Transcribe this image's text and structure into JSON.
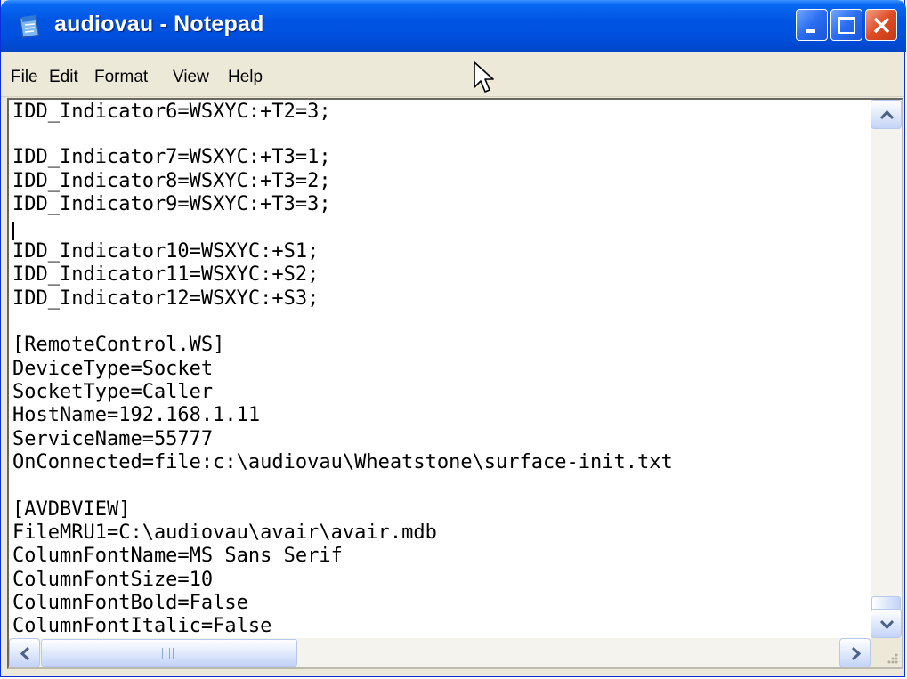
{
  "window": {
    "title": "audiovau - Notepad",
    "colors": {
      "titlebar": "#0054e3",
      "close": "#e04a22",
      "menubar": "#ece9d8"
    }
  },
  "titlebar": {
    "icons": {
      "app": "notepad-icon",
      "minimize": "minimize-icon",
      "maximize": "maximize-icon",
      "close": "close-icon"
    }
  },
  "menu": {
    "items": [
      "File",
      "Edit",
      "Format",
      "View",
      "Help"
    ]
  },
  "editor": {
    "lines": [
      "IDD_Indicator6=WSXYC:+T2=3;",
      "",
      "IDD_Indicator7=WSXYC:+T3=1;",
      "IDD_Indicator8=WSXYC:+T3=2;",
      "IDD_Indicator9=WSXYC:+T3=3;",
      "",
      "IDD_Indicator10=WSXYC:+S1;",
      "IDD_Indicator11=WSXYC:+S2;",
      "IDD_Indicator12=WSXYC:+S3;",
      "",
      "[RemoteControl.WS]",
      "DeviceType=Socket",
      "SocketType=Caller",
      "HostName=192.168.1.11",
      "ServiceName=55777",
      "OnConnected=file:c:\\audiovau\\Wheatstone\\surface-init.txt",
      "",
      "[AVDBVIEW]",
      "FileMRU1=C:\\audiovau\\avair\\avair.mdb",
      "ColumnFontName=MS Sans Serif",
      "ColumnFontSize=10",
      "ColumnFontBold=False",
      "ColumnFontItalic=False"
    ]
  },
  "scrollbars": {
    "icons": {
      "up": "scroll-up-arrow-icon",
      "down": "scroll-down-arrow-icon",
      "left": "scroll-left-arrow-icon",
      "right": "scroll-right-arrow-icon"
    }
  }
}
